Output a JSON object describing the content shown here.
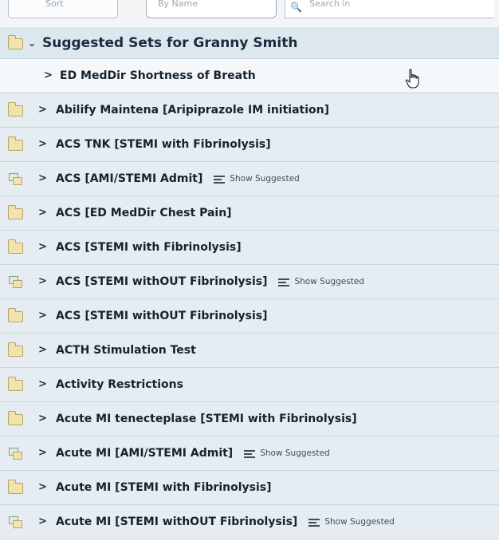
{
  "toolbar": {
    "segment_one_text": "Sort",
    "sort_select_text": "By Name",
    "search_placeholder": "Search in"
  },
  "header": {
    "title": "Suggested Sets for Granny Smith"
  },
  "rows": [
    {
      "label": "ED MedDir Shortness of Breath",
      "icon": "none",
      "show_suggested": false,
      "sub": true
    },
    {
      "label": "Abilify Maintena [Aripiprazole IM initiation]",
      "icon": "folder-icon",
      "show_suggested": false
    },
    {
      "label": "ACS TNK [STEMI with Fibrinolysis]",
      "icon": "folder-icon",
      "show_suggested": false
    },
    {
      "label": "ACS [AMI/STEMI Admit]",
      "icon": "order-set-icon",
      "show_suggested": true
    },
    {
      "label": "ACS [ED MedDir Chest Pain]",
      "icon": "folder-icon",
      "show_suggested": false
    },
    {
      "label": "ACS [STEMI with Fibrinolysis]",
      "icon": "folder-icon",
      "show_suggested": false
    },
    {
      "label": "ACS [STEMI withOUT Fibrinolysis]",
      "icon": "order-set-icon",
      "show_suggested": true
    },
    {
      "label": "ACS [STEMI withOUT Fibrinolysis]",
      "icon": "folder-icon",
      "show_suggested": false
    },
    {
      "label": "ACTH Stimulation Test",
      "icon": "folder-icon",
      "show_suggested": false
    },
    {
      "label": "Activity Restrictions",
      "icon": "folder-icon",
      "show_suggested": false
    },
    {
      "label": "Acute MI tenecteplase [STEMI with Fibrinolysis]",
      "icon": "folder-icon",
      "show_suggested": false
    },
    {
      "label": "Acute MI [AMI/STEMI Admit]",
      "icon": "order-set-icon",
      "show_suggested": true
    },
    {
      "label": "Acute MI [STEMI with Fibrinolysis]",
      "icon": "folder-icon",
      "show_suggested": false
    },
    {
      "label": "Acute MI [STEMI withOUT Fibrinolysis]",
      "icon": "order-set-icon",
      "show_suggested": true
    }
  ],
  "show_suggested_label": "Show Suggested",
  "chevrons": {
    "expanded": "⌄",
    "collapsed": ">"
  }
}
